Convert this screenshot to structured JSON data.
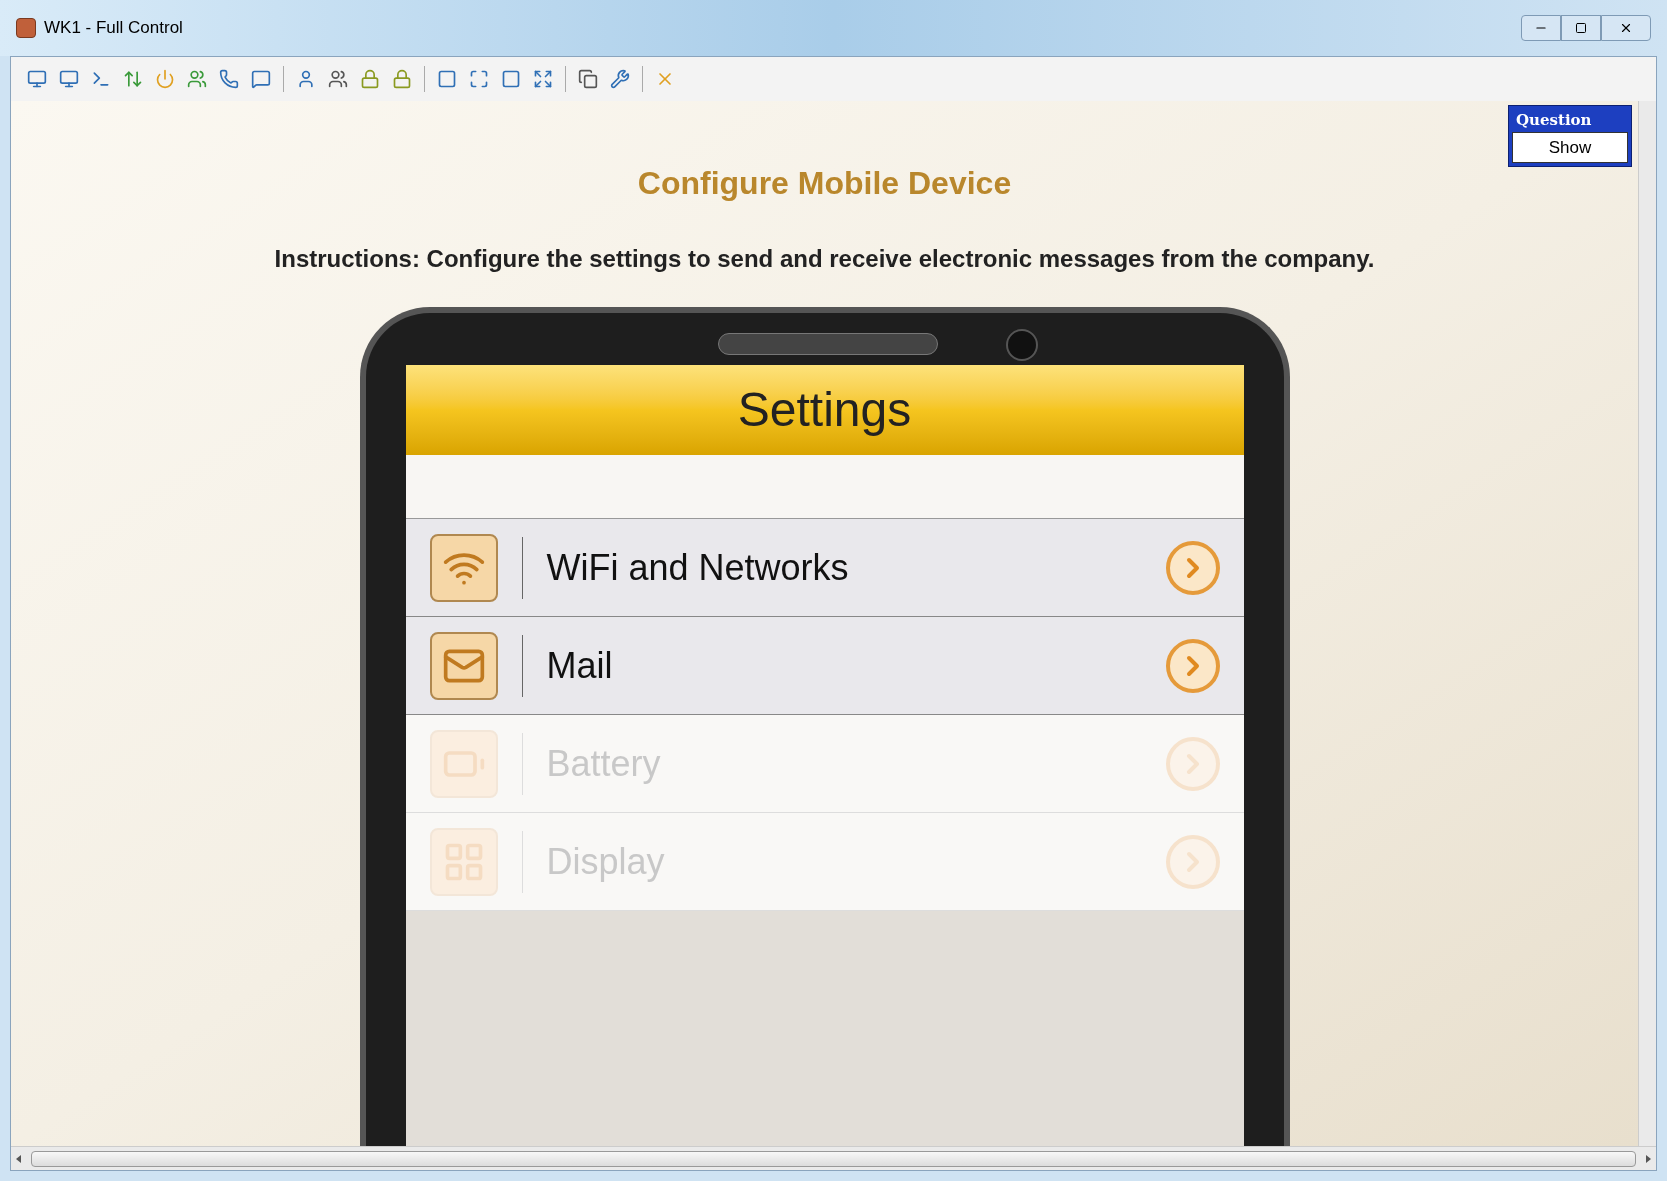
{
  "window": {
    "title": "WK1 - Full Control"
  },
  "question_panel": {
    "title": "Question",
    "button": "Show"
  },
  "page": {
    "title": "Configure Mobile Device",
    "instructions": "Instructions: Configure the settings to send and receive electronic messages from the company."
  },
  "phone": {
    "header": "Settings",
    "items": [
      {
        "label": "WiFi and Networks",
        "disabled": false
      },
      {
        "label": "Mail",
        "disabled": false
      },
      {
        "label": "Battery",
        "disabled": true
      },
      {
        "label": "Display",
        "disabled": true
      }
    ]
  }
}
